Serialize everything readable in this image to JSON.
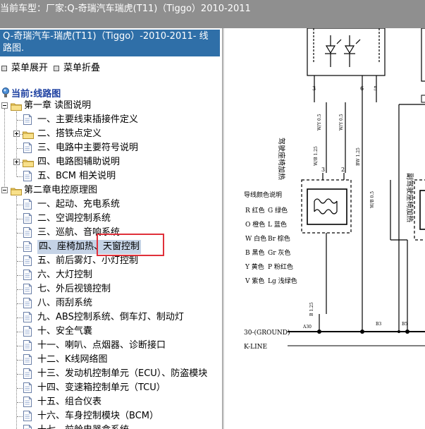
{
  "topbar": {
    "label": "当前车型：",
    "vehicle": "厂家:Q-奇瑞汽车瑞虎(T11)（Tiggo）2010-2011"
  },
  "tree": {
    "header": "Q-奇瑞汽车-瑞虎(T11)（Tiggo）-2010-2011- 线路图.",
    "expand_all": "菜单展开",
    "collapse_all": "菜单折叠",
    "current": "当前:线路图",
    "chapter1": {
      "title": "第一章 读图说明",
      "items": [
        "一、主要线束插接件定义",
        "二、搭铁点定义",
        "三、电路中主要符号说明",
        "四、电路图辅助说明",
        "五、BCM 相关说明"
      ]
    },
    "chapter2": {
      "title": "第二章电控原理图",
      "items": [
        "一、起动、充电系统",
        "二、空调控制系统",
        "三、巡航、音响系统",
        "四、座椅加热、天窗控制",
        "五、前后雾灯、小灯控制",
        "六、大灯控制",
        "七、外后视镜控制",
        "八、雨刮系统",
        "九、ABS控制系统、倒车灯、制动灯",
        "十、安全气囊",
        "十一、喇叭、点烟器、诊断接口",
        "十二、K线网络图",
        "十三、发动机控制单元（ECU）、防盗模块",
        "十四、变速箱控制单元（TCU）",
        "十五、组合仪表",
        "十六、车身控制模块（BCM）",
        "十七、前舱电器盒系统"
      ]
    }
  },
  "schematic": {
    "pins_top": [
      "3",
      "6",
      "5"
    ],
    "wire_codes": [
      "W/Y 0.5",
      "W/Y 0.5",
      "W/B 1.25",
      "BW 1.25",
      "W/B 0.5"
    ],
    "pins_mid": [
      "3",
      "2"
    ],
    "seat_left": "驾驶座椅加热",
    "seat_right": "副驾驶座椅加热",
    "color_legend_title": "导线颜色说明",
    "color_legend": [
      [
        "R 红色",
        "G 绿色"
      ],
      [
        "O 橙色",
        "L 蓝色"
      ],
      [
        "W 白色",
        "Br 棕色"
      ],
      [
        "B 黑色",
        "Gr 灰色"
      ],
      [
        "Y 黄色",
        "P 粉红色"
      ],
      [
        "V 紫色",
        "Lg 浅绿色"
      ]
    ],
    "ground_codes": [
      "A30",
      "B3",
      "B5"
    ],
    "wire_bottom": "B 1.25",
    "ground_label": "30-(GROUND)",
    "kline_label": "K-LINE"
  }
}
